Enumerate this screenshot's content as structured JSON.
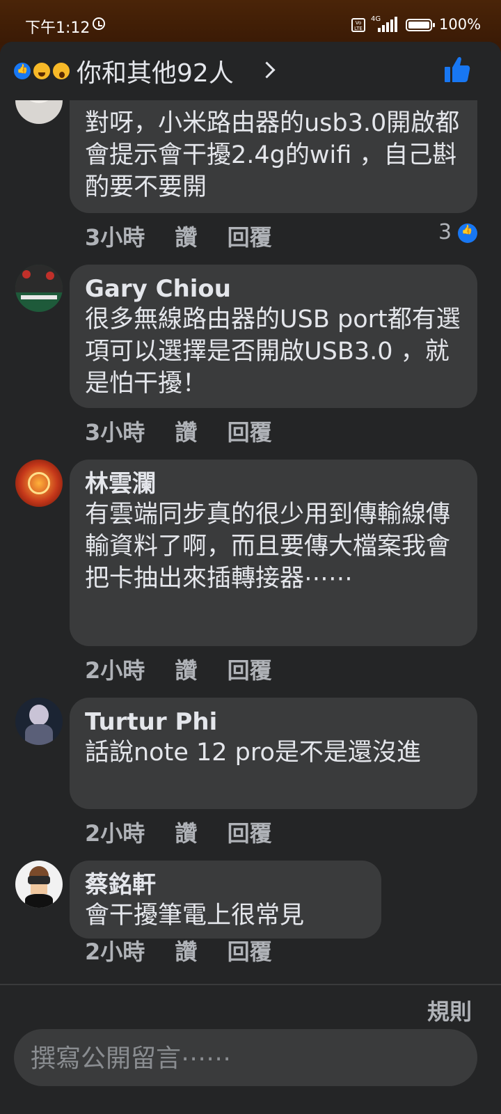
{
  "status_bar": {
    "time": "下午1:12",
    "network": "4G",
    "volte": "Vo LTE",
    "battery_percent": "100%"
  },
  "reactions_bar": {
    "summary": "你和其他92人",
    "reaction_icons": [
      "like-icon",
      "haha-icon",
      "wow-icon"
    ]
  },
  "comments": [
    {
      "author": "",
      "text": "對呀，小米路由器的usb3.0開啟都會提示會干擾2.4g的wifi ，自己斟酌要不要開",
      "time": "3小時",
      "like_label": "讚",
      "reply_label": "回覆",
      "like_count": "3"
    },
    {
      "author": "Gary Chiou",
      "text": "很多無線路由器的USB port都有選項可以選擇是否開啟USB3.0 ，就是怕干擾！",
      "time": "3小時",
      "like_label": "讚",
      "reply_label": "回覆"
    },
    {
      "author": "林雲瀾",
      "text": "有雲端同步真的很少用到傳輸線傳輸資料了啊，而且要傳大檔案我會把卡抽出來插轉接器⋯⋯",
      "time": "2小時",
      "like_label": "讚",
      "reply_label": "回覆"
    },
    {
      "author": "Turtur Phi",
      "text": "話說note 12 pro是不是還沒進",
      "time": "2小時",
      "like_label": "讚",
      "reply_label": "回覆"
    },
    {
      "author": "蔡銘軒",
      "text": "會干擾筆電上很常見",
      "time": "2小時",
      "like_label": "讚",
      "reply_label": "回覆"
    }
  ],
  "footer": {
    "rules_label": "規則",
    "compose_placeholder": "撰寫公開留言⋯⋯"
  },
  "colors": {
    "accent": "#1877f2",
    "sheet_bg": "#242526",
    "bubble_bg": "#3a3b3c",
    "status_bg": "#3b1a06"
  }
}
